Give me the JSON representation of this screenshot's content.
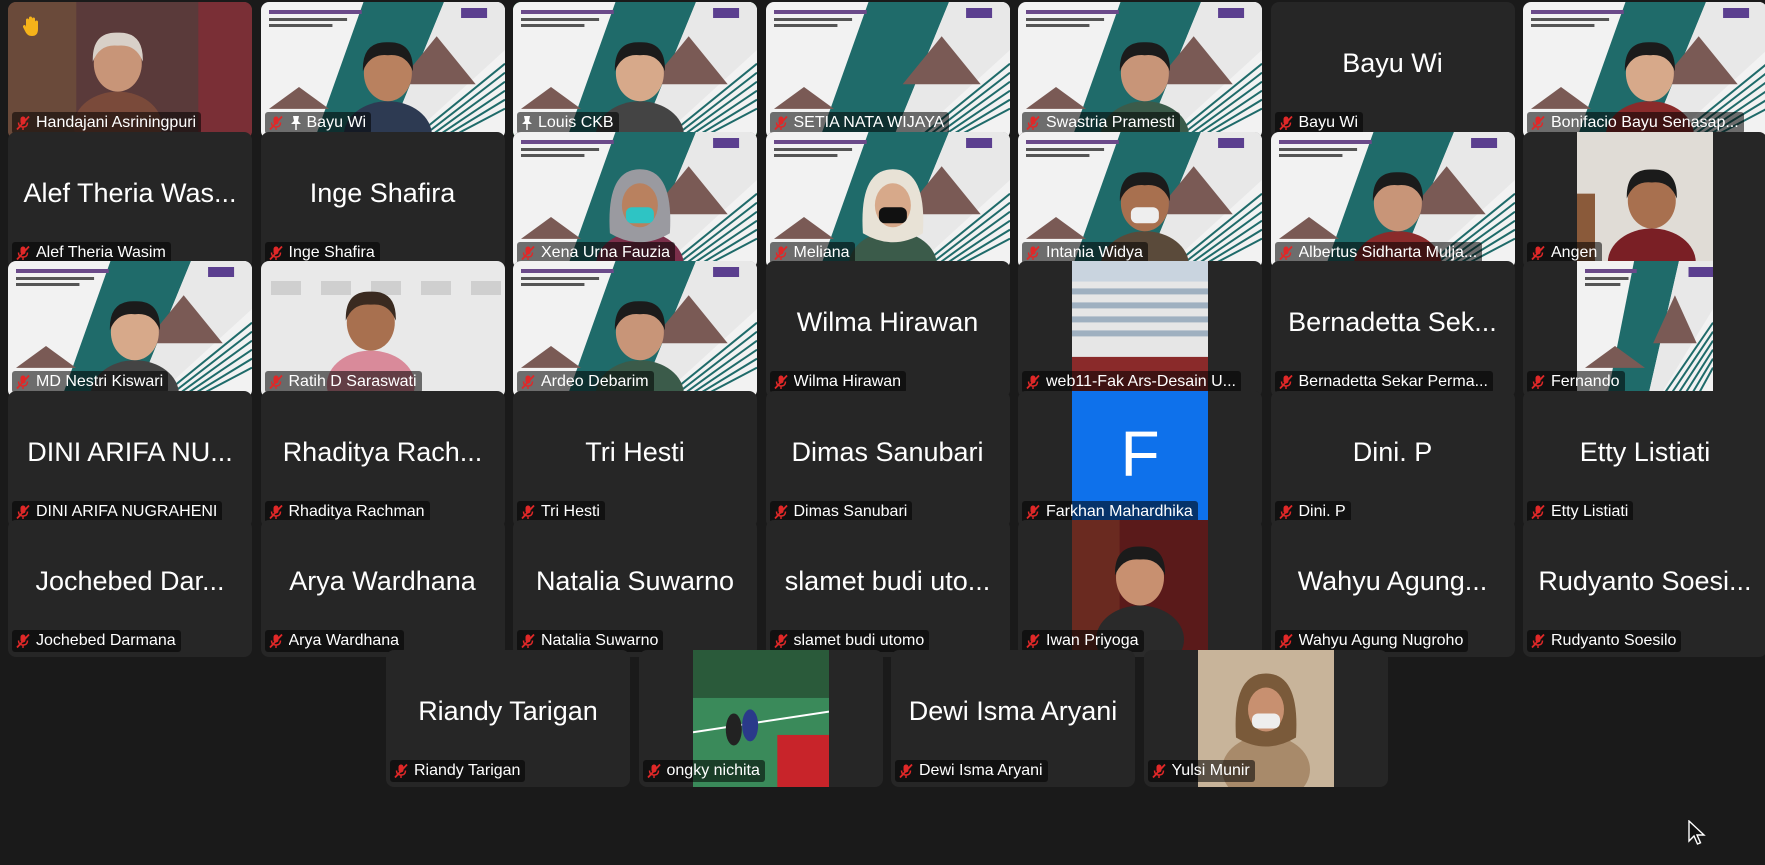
{
  "colors": {
    "background": "#1a1a1a",
    "tile": "#262626",
    "active_border": "#23d160",
    "muted_icon": "#e02828",
    "avatar_blue": "#0e71eb"
  },
  "participants": [
    {
      "name": "Handajani Asriningpuri",
      "video": true,
      "kind": "webcam",
      "raised_hand": true
    },
    {
      "name": "Bayu Wi",
      "video": true,
      "kind": "slide-cam",
      "pinned": true
    },
    {
      "name": "Louis CKB",
      "video": true,
      "kind": "slide-cam",
      "active": true,
      "label_icon": "pin"
    },
    {
      "name": "SETIA NATA WIJAYA",
      "video": true,
      "kind": "slide"
    },
    {
      "name": "Swastria Pramesti",
      "video": true,
      "kind": "slide-cam"
    },
    {
      "name": "Bayu Wi",
      "video": false,
      "display": "Bayu Wi"
    },
    {
      "name": "Bonifacio Bayu Senasap...",
      "video": true,
      "kind": "slide-cam"
    },
    {
      "name": "Alef Theria Wasim",
      "video": false,
      "display": "Alef Theria Was..."
    },
    {
      "name": "Inge Shafira",
      "video": false,
      "display": "Inge Shafira"
    },
    {
      "name": "Xena Urna Fauzia",
      "video": true,
      "kind": "slide-cam"
    },
    {
      "name": "Meliana",
      "video": true,
      "kind": "slide-cam"
    },
    {
      "name": "Intania Widya",
      "video": true,
      "kind": "slide-cam"
    },
    {
      "name": "Albertus Sidharta Mulja...",
      "video": true,
      "kind": "slide-cam"
    },
    {
      "name": "Angen",
      "video": true,
      "kind": "webcam-narrow"
    },
    {
      "name": "MD Nestri Kiswari",
      "video": true,
      "kind": "slide-cam"
    },
    {
      "name": "Ratih D Saraswati",
      "video": true,
      "kind": "webcam"
    },
    {
      "name": "Ardeo Debarim",
      "video": true,
      "kind": "slide-cam"
    },
    {
      "name": "Wilma Hirawan",
      "video": false,
      "display": "Wilma Hirawan"
    },
    {
      "name": "web11-Fak Ars-Desain U...",
      "video": true,
      "kind": "building-narrow"
    },
    {
      "name": "Bernadetta Sekar Perma...",
      "video": false,
      "display": "Bernadetta Sek..."
    },
    {
      "name": "Fernando",
      "video": true,
      "kind": "slide-narrow"
    },
    {
      "name": "DINI ARIFA NUGRAHENI",
      "video": false,
      "display": "DINI ARIFA NU..."
    },
    {
      "name": "Rhaditya Rachman",
      "video": false,
      "display": "Rhaditya Rach..."
    },
    {
      "name": "Tri Hesti",
      "video": false,
      "display": "Tri Hesti"
    },
    {
      "name": "Dimas Sanubari",
      "video": false,
      "display": "Dimas Sanubari"
    },
    {
      "name": "Farkhan Mahardhika",
      "video": true,
      "kind": "avatar",
      "avatar_letter": "F"
    },
    {
      "name": "Dini. P",
      "video": false,
      "display": "Dini. P"
    },
    {
      "name": "Etty Listiati",
      "video": false,
      "display": "Etty Listiati"
    },
    {
      "name": "Jochebed Darmana",
      "video": false,
      "display": "Jochebed Dar..."
    },
    {
      "name": "Arya Wardhana",
      "video": false,
      "display": "Arya Wardhana"
    },
    {
      "name": "Natalia Suwarno",
      "video": false,
      "display": "Natalia Suwarno"
    },
    {
      "name": "slamet budi utomo",
      "video": false,
      "display": "slamet budi uto..."
    },
    {
      "name": "Iwan Priyoga",
      "video": true,
      "kind": "portrait-narrow"
    },
    {
      "name": "Wahyu Agung Nugroho",
      "video": false,
      "display": "Wahyu Agung..."
    },
    {
      "name": "Rudyanto Soesilo",
      "video": false,
      "display": "Rudyanto Soesi..."
    },
    {
      "name": "Riandy Tarigan",
      "video": false,
      "display": "Riandy Tarigan"
    },
    {
      "name": "ongky nichita",
      "video": true,
      "kind": "badminton-narrow"
    },
    {
      "name": "Dewi Isma Aryani",
      "video": false,
      "display": "Dewi Isma Aryani"
    },
    {
      "name": "Yulsi Munir",
      "video": true,
      "kind": "portrait-narrow"
    }
  ]
}
